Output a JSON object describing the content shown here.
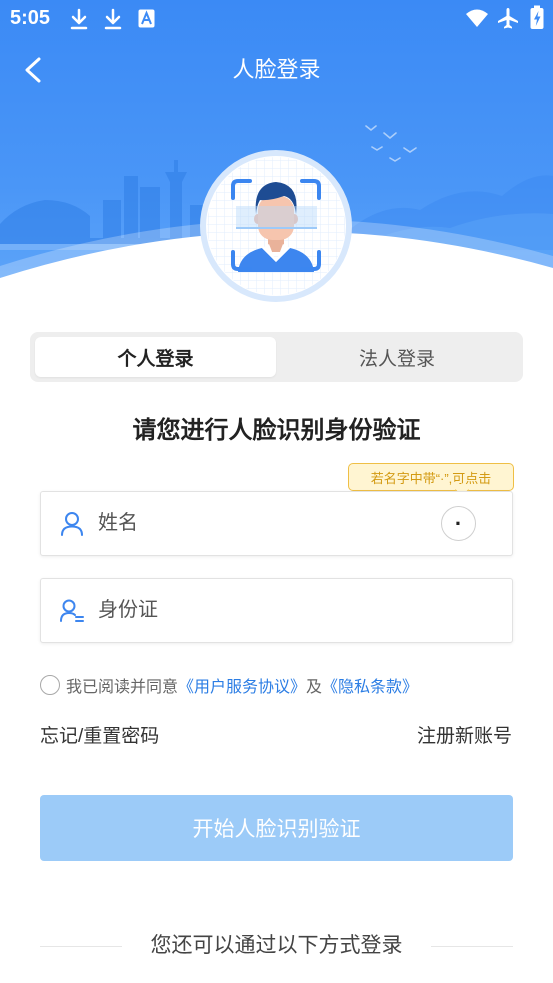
{
  "status_bar": {
    "time": "5:05",
    "left_icons": [
      "download-icon",
      "download-icon",
      "font-download-icon"
    ],
    "right_icons": [
      "wifi-icon",
      "airplane-mode-icon",
      "battery-charging-icon"
    ]
  },
  "header": {
    "back_icon": "chevron-left-icon",
    "title": "人脸登录"
  },
  "hero": {
    "illustration": "face-scan-avatar-icon"
  },
  "tabs": [
    {
      "label": "个人登录",
      "active": true
    },
    {
      "label": "法人登录",
      "active": false
    }
  ],
  "heading": "请您进行人脸识别身份验证",
  "tooltip": "若名字中带“·”,可点击",
  "form": {
    "name": {
      "icon": "user-icon",
      "placeholder": "姓名",
      "value": "",
      "dot_button": "·"
    },
    "id_card": {
      "icon": "id-card-icon",
      "placeholder": "身份证",
      "value": ""
    }
  },
  "agreement": {
    "checked": false,
    "prefix": "我已阅读并同意",
    "terms_link": "《用户服务协议》",
    "joiner": "及",
    "privacy_link": "《隐私条款》"
  },
  "links": {
    "forgot_password": "忘记/重置密码",
    "register": "注册新账号"
  },
  "submit": {
    "label": "开始人脸识别验证",
    "enabled": false
  },
  "alt_login": {
    "label": "您还可以通过以下方式登录"
  },
  "colors": {
    "primary": "#3d8bf5",
    "button_disabled": "#9ccbf8",
    "link": "#2b7de4",
    "tooltip_bg": "#fff5d2",
    "tooltip_text": "#d39a12"
  }
}
